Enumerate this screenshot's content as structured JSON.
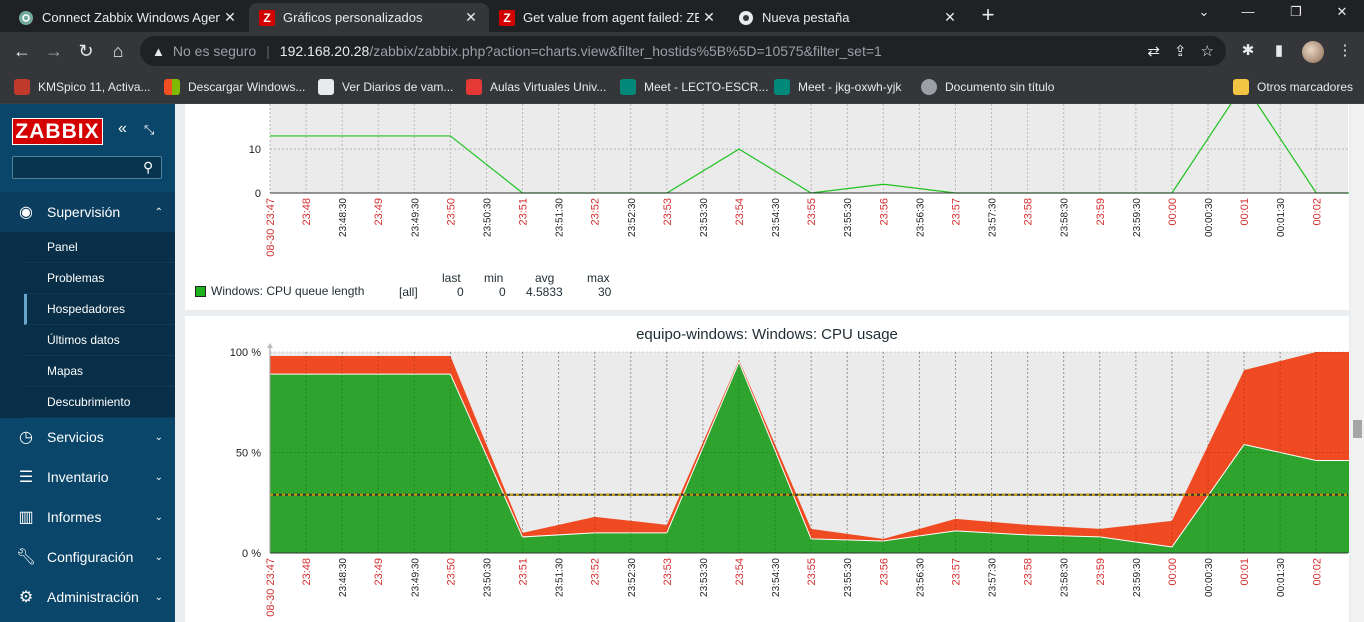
{
  "browser": {
    "tabs": [
      {
        "title": "Connect Zabbix Windows Agent",
        "active": false
      },
      {
        "title": "Gráficos personalizados",
        "active": true
      },
      {
        "title": "Get value from agent failed: ZBX_",
        "active": false
      },
      {
        "title": "Nueva pestaña",
        "active": false
      }
    ],
    "insecure_label": "No es seguro",
    "url_host": "192.168.20.28",
    "url_path": "/zabbix/zabbix.php?action=charts.view&filter_hostids%5B%5D=10575&filter_set=1",
    "bookmarks": [
      "KMSpico 11, Activa...",
      "Descargar Windows...",
      "Ver Diarios de vam...",
      "Aulas Virtuales Univ...",
      "Meet - LECTO-ESCR...",
      "Meet - jkg-oxwh-yjk",
      "Documento sin título"
    ],
    "other_bookmarks": "Otros marcadores"
  },
  "sidebar": {
    "logo": "ZABBIX",
    "search_placeholder": "",
    "sections": [
      {
        "label": "Supervisión",
        "icon": "eye-icon",
        "open": true
      },
      {
        "label": "Servicios",
        "icon": "clock-icon"
      },
      {
        "label": "Inventario",
        "icon": "list-icon"
      },
      {
        "label": "Informes",
        "icon": "bar-chart-icon"
      },
      {
        "label": "Configuración",
        "icon": "wrench-icon"
      },
      {
        "label": "Administración",
        "icon": "gear-icon"
      }
    ],
    "submenu": [
      {
        "label": "Panel"
      },
      {
        "label": "Problemas"
      },
      {
        "label": "Hospedadores",
        "selected": true
      },
      {
        "label": "Últimos datos"
      },
      {
        "label": "Mapas"
      },
      {
        "label": "Descubrimiento"
      }
    ]
  },
  "time_axis": {
    "labels": [
      "08-30 23:47",
      "23:48",
      "23:48:30",
      "23:49",
      "23:49:30",
      "23:50",
      "23:50:30",
      "23:51",
      "23:51:30",
      "23:52",
      "23:52:30",
      "23:53",
      "23:53:30",
      "23:54",
      "23:54:30",
      "23:55",
      "23:55:30",
      "23:56",
      "23:56:30",
      "23:57",
      "23:57:30",
      "23:58",
      "23:58:30",
      "23:59",
      "23:59:30",
      "00:00",
      "00:00:30",
      "00:01",
      "00:01:30",
      "00:02"
    ],
    "red": [
      true,
      true,
      false,
      true,
      false,
      true,
      false,
      true,
      false,
      true,
      false,
      true,
      false,
      true,
      false,
      true,
      false,
      true,
      false,
      true,
      false,
      true,
      false,
      true,
      false,
      true,
      false,
      true,
      false,
      true
    ]
  },
  "legend1": {
    "series_name": "Windows: CPU queue length",
    "mode": "[all]",
    "headers": [
      "last",
      "min",
      "avg",
      "max"
    ],
    "values": [
      "0",
      "0",
      "4.5833",
      "30"
    ],
    "color": "#1fb21f"
  },
  "colors": {
    "green": "#2ea42e",
    "red": "#f04a22",
    "line_green": "#1fc21f",
    "trigger": "#c8a000"
  },
  "chart_data": [
    {
      "type": "line",
      "x": [
        "23:47",
        "23:49:30",
        "23:50:30",
        "23:51:30",
        "23:52:30",
        "23:53:30",
        "23:54:30",
        "23:55:30",
        "23:56:30",
        "23:57:30",
        "23:58:30",
        "23:59:30",
        "00:00:30",
        "00:01:30",
        "00:02"
      ],
      "series": [
        {
          "name": "Windows: CPU queue length",
          "values": [
            13,
            13,
            0,
            0,
            0,
            10,
            0,
            2,
            0,
            0,
            0,
            0,
            30,
            0,
            0
          ]
        }
      ],
      "yticks": [
        "0",
        "10"
      ],
      "ylim": [
        0,
        18
      ]
    },
    {
      "type": "area",
      "title": "equipo-windows: Windows: CPU usage",
      "x": [
        "23:47",
        "23:49:30",
        "23:50:30",
        "23:51:30",
        "23:52:30",
        "23:53:30",
        "23:54:30",
        "23:55:30",
        "23:56:30",
        "23:57:30",
        "23:58:30",
        "23:59:30",
        "00:00:30",
        "00:01:30",
        "00:02"
      ],
      "series": [
        {
          "values": [
            89,
            89,
            8,
            10,
            10,
            95,
            7,
            6,
            11,
            9,
            8,
            3,
            54,
            46,
            46
          ]
        },
        {
          "values": [
            98,
            98,
            10,
            18,
            14,
            96,
            12,
            7,
            17,
            14,
            12,
            16,
            91,
            100,
            100
          ]
        }
      ],
      "yticks": [
        "0 %",
        "50 %",
        "100 %"
      ],
      "ylim": [
        0,
        100
      ],
      "trigger_line": 29
    }
  ]
}
